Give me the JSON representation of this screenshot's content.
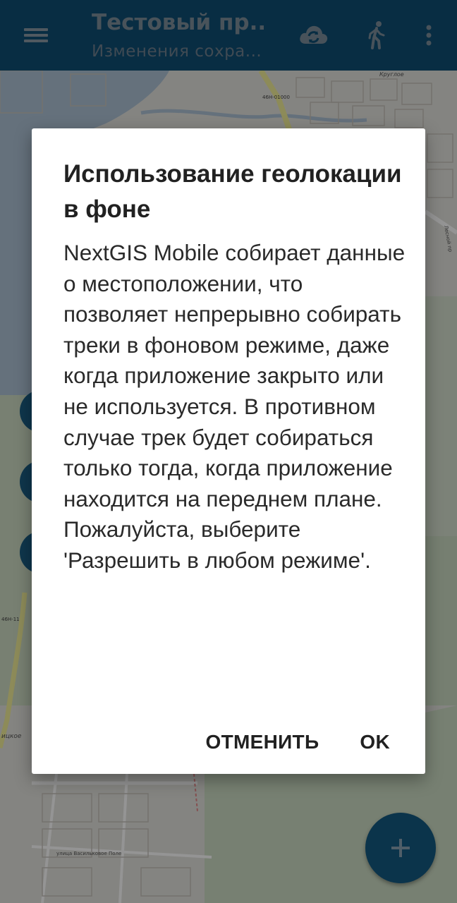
{
  "toolbar": {
    "title": "Тестовый пр...",
    "subtitle": "Изменения сохра...",
    "icons": {
      "menu": "hamburger-menu-icon",
      "sync": "cloud-sync-icon",
      "track": "walking-person-icon",
      "more": "more-vert-icon"
    }
  },
  "map": {
    "labels": {
      "road1": "46Н-01000",
      "road2": "46Н-11",
      "village": "Круглое",
      "street": "улица Васильковое Поле",
      "settlement": "ицкое",
      "street2": "Лесной пр"
    }
  },
  "dialog": {
    "title": "Использование геолокации в фоне",
    "message": "NextGIS Mobile собирает данные о местоположении, что позволяет непрерывно собирать треки в фоновом режиме, даже когда приложение закрыто или не используется. В противном случае трек будет собираться только тогда, когда приложение находится на переднем плане. Пожалуйста, выберите 'Разрешить в любом режиме'.",
    "cancel_label": "ОТМЕНИТЬ",
    "ok_label": "OK"
  },
  "fab": {
    "icon": "plus-icon"
  },
  "colors": {
    "toolbar": "#0e4f74",
    "accent": "#135a82",
    "dialog_bg": "#ffffff",
    "text": "#212121"
  }
}
